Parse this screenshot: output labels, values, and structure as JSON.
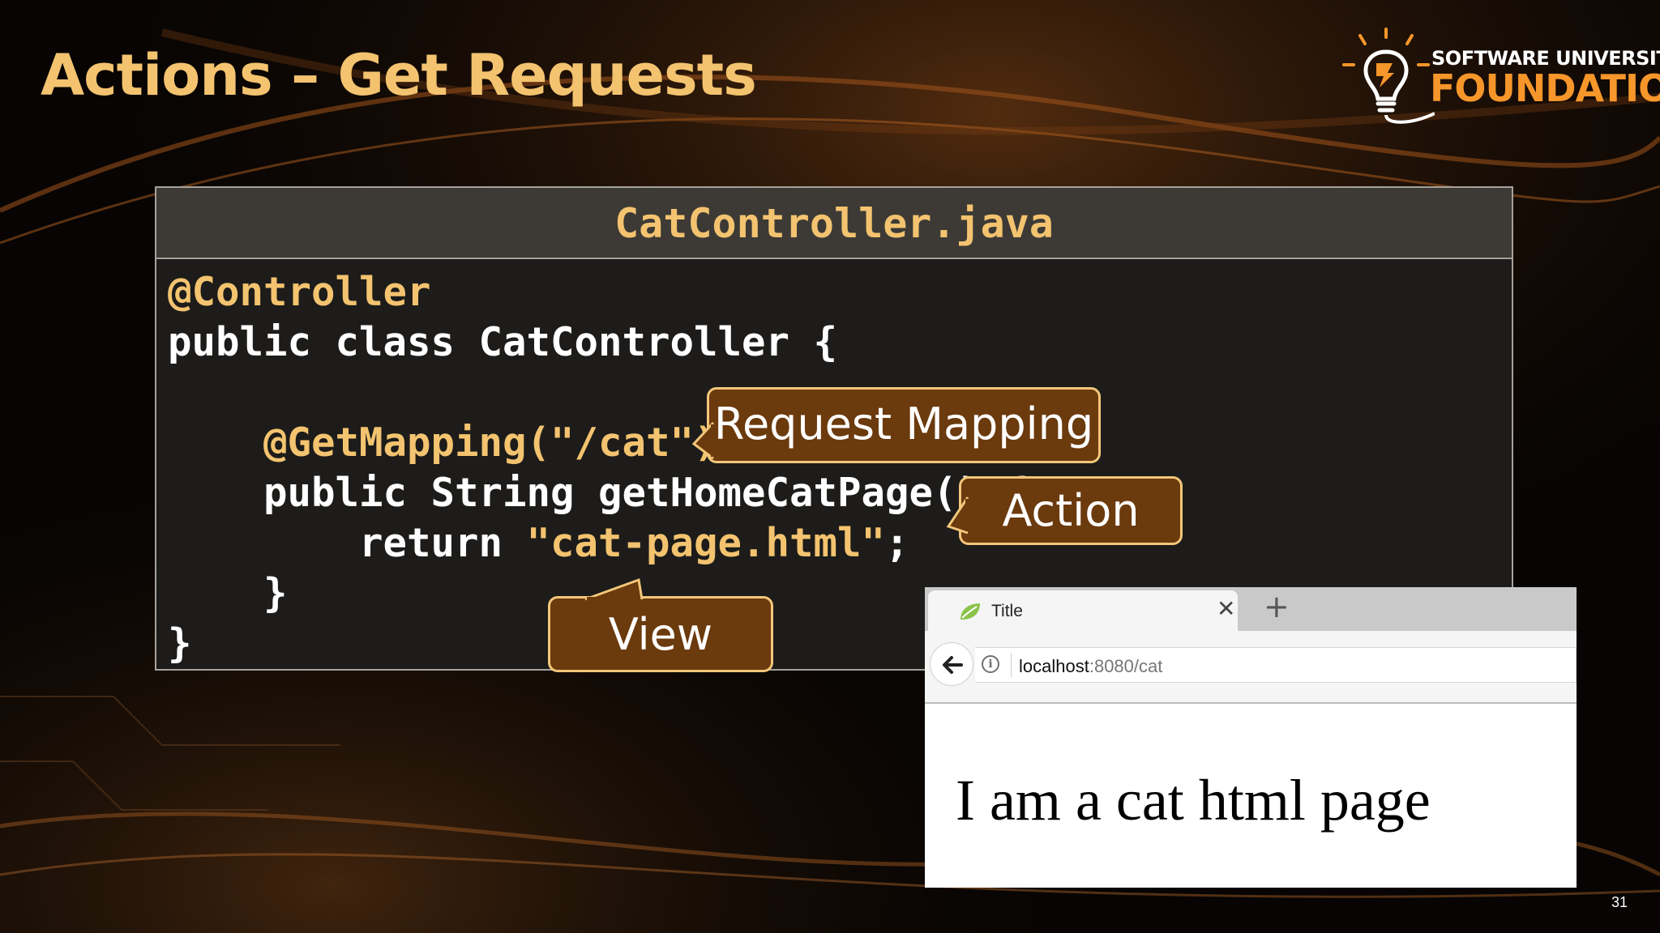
{
  "slide": {
    "title": "Actions – Get Requests",
    "number": "31"
  },
  "logo": {
    "line1": "SOFTWARE UNIVERSITY",
    "line2": "FOUNDATION",
    "icon": "lightbulb-icon"
  },
  "code": {
    "filename": "CatController.java",
    "lines": [
      {
        "anno": "@Controller",
        "text": "",
        "str": "",
        "end": ""
      },
      {
        "anno": "",
        "text": "public class CatController {",
        "str": "",
        "end": ""
      },
      {
        "anno": "",
        "text": "",
        "str": "",
        "end": ""
      },
      {
        "anno": "    @GetMapping(\"/cat\")",
        "text": "",
        "str": "",
        "end": ""
      },
      {
        "anno": "",
        "text": "    public String getHomeCatPage() {",
        "str": "",
        "end": ""
      },
      {
        "anno": "",
        "text": "        return ",
        "str": "\"cat-page.html\"",
        "end": ";"
      },
      {
        "anno": "",
        "text": "    }",
        "str": "",
        "end": ""
      },
      {
        "anno": "",
        "text": "}",
        "str": "",
        "end": ""
      }
    ]
  },
  "callouts": {
    "mapping": "Request Mapping",
    "action": "Action",
    "view": "View"
  },
  "browser": {
    "tab_title": "Title",
    "tab_icon": "spring-leaf-icon",
    "url_host": "localhost",
    "url_path": ":8080/cat",
    "page_text": "I am a cat html page"
  },
  "colors": {
    "title": "#f3c36f",
    "accent": "#f7962a",
    "callout_bg": "#6b3a0d",
    "callout_border": "#f3c67a"
  }
}
